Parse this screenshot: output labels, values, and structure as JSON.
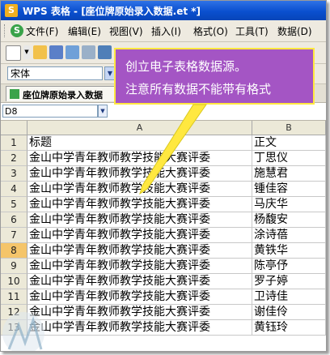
{
  "window": {
    "title": "WPS 表格 - [座位牌原始录入数据.et *]",
    "app_icon": "S"
  },
  "menu": {
    "items": [
      "文件(F)",
      "编辑(E)",
      "视图(V)",
      "插入(I)",
      "格式(O)",
      "工具(T)",
      "数据(D)"
    ]
  },
  "fontbar": {
    "font_name": "宋体"
  },
  "tab": {
    "label": "座位牌原始录入数据"
  },
  "formula": {
    "cell_ref": "D8"
  },
  "columns": [
    "A",
    "B"
  ],
  "rows": [
    {
      "num": "1",
      "a": "标题",
      "b": "正文"
    },
    {
      "num": "2",
      "a": "金山中学青年教师教学技能大赛评委",
      "b": "丁思仪"
    },
    {
      "num": "3",
      "a": "金山中学青年教师教学技能大赛评委",
      "b": "施慧君"
    },
    {
      "num": "4",
      "a": "金山中学青年教师教学技能大赛评委",
      "b": "锺佳容"
    },
    {
      "num": "5",
      "a": "金山中学青年教师教学技能大赛评委",
      "b": "马庆华"
    },
    {
      "num": "6",
      "a": "金山中学青年教师教学技能大赛评委",
      "b": "杨馥安"
    },
    {
      "num": "7",
      "a": "金山中学青年教师教学技能大赛评委",
      "b": "涂诗蓓"
    },
    {
      "num": "8",
      "a": "金山中学青年教师教学技能大赛评委",
      "b": "黄铁华"
    },
    {
      "num": "9",
      "a": "金山中学青年教师教学技能大赛评委",
      "b": "陈亭伃"
    },
    {
      "num": "10",
      "a": "金山中学青年教师教学技能大赛评委",
      "b": "罗子婷"
    },
    {
      "num": "11",
      "a": "金山中学青年教师教学技能大赛评委",
      "b": "卫诗佳"
    },
    {
      "num": "12",
      "a": "金山中学青年教师教学技能大赛评委",
      "b": "谢佳伶"
    },
    {
      "num": "13",
      "a": "金山中学青年教师教学技能大赛评委",
      "b": "黄钰玲"
    }
  ],
  "active_row": "8",
  "callout": {
    "line1": "创立电子表格数据源。",
    "line2": "注意所有数据不能带有格式"
  },
  "colors": {
    "titlebar": "#0a4fcf",
    "callout_fill": "#a455c4",
    "callout_border": "#ffe840",
    "active_row": "#f5c56a"
  }
}
